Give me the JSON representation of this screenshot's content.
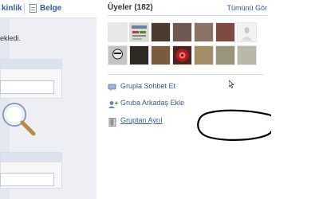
{
  "left": {
    "tabs": [
      {
        "label": "kinlik"
      },
      {
        "label": "Belge"
      }
    ],
    "status_text": "ekledi."
  },
  "members": {
    "title": "Üyeler (182)",
    "see_all": "Tümünü Gör",
    "avatar_count": 14
  },
  "actions": [
    {
      "label": "Grupla Sohbet Et",
      "icon": "chat-icon"
    },
    {
      "label": "Gruba Arkadaş Ekle",
      "icon": "add-friend-icon"
    },
    {
      "label": "Gruptan Ayrıl",
      "icon": "leave-door-icon"
    }
  ],
  "colors": {
    "link": "#3b5998",
    "panel_bg": "#edeff4",
    "divider": "#d8dfea",
    "annotation": "#000000"
  }
}
